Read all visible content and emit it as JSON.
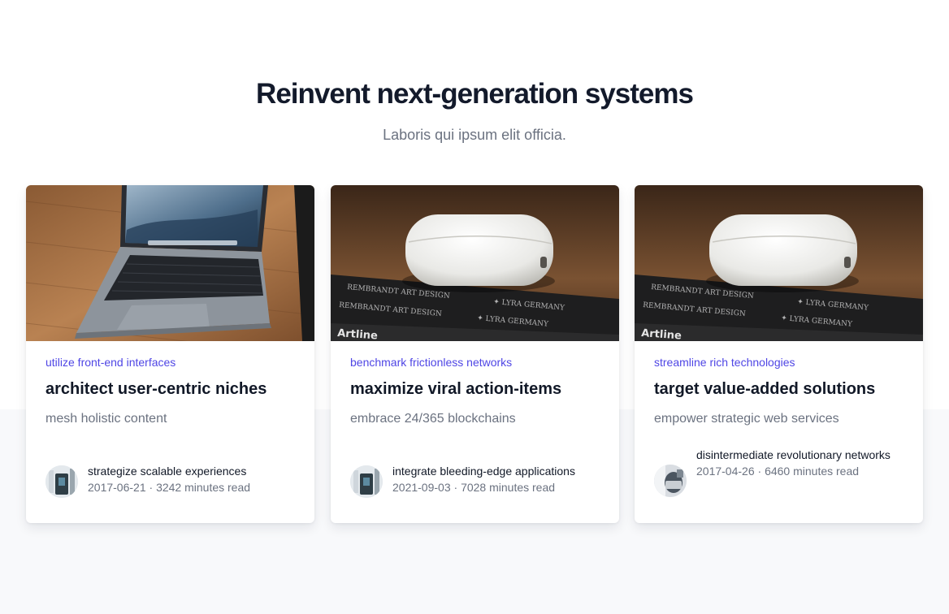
{
  "header": {
    "title": "Reinvent next-generation systems",
    "subtitle": "Laboris qui ipsum elit officia."
  },
  "cards": [
    {
      "image_icon": "laptop-photo",
      "category": "utilize front-end interfaces",
      "title": "architect user-centric niches",
      "excerpt": "mesh holistic content",
      "author": "strategize scalable experiences",
      "date": "2017-06-21",
      "separator": "·",
      "read_time": "3242 minutes read"
    },
    {
      "image_icon": "earbuds-case-photo",
      "category": "benchmark frictionless networks",
      "title": "maximize viral action-items",
      "excerpt": "embrace 24/365 blockchains",
      "author": "integrate bleeding-edge applications",
      "date": "2021-09-03",
      "separator": "·",
      "read_time": "7028 minutes read"
    },
    {
      "image_icon": "earbuds-case-photo",
      "category": "streamline rich technologies",
      "title": "target value-added solutions",
      "excerpt": "empower strategic web services",
      "author": "disintermediate revolutionary networks",
      "date": "2017-04-26",
      "separator": "·",
      "read_time": "6460 minutes read"
    }
  ],
  "colors": {
    "accent": "#4f46e5",
    "heading": "#131a2b",
    "muted": "#6b7280",
    "band": "#f8f9fb"
  }
}
